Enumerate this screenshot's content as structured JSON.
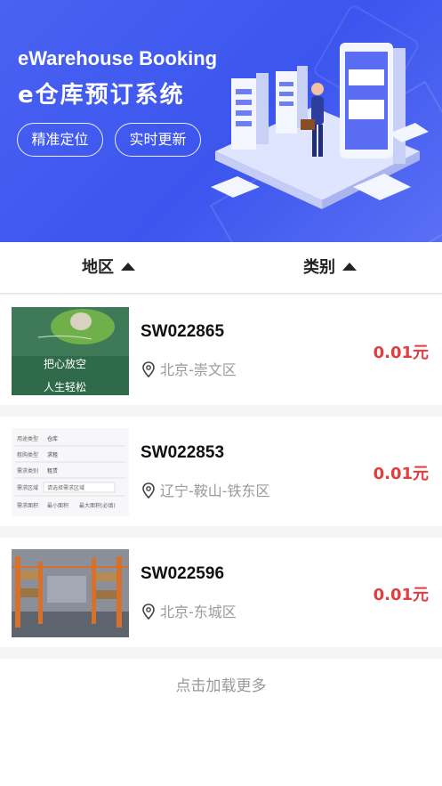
{
  "banner": {
    "title_en": "eWarehouse Booking",
    "title_cn": "e仓库预订系统",
    "pill_1": "精准定位",
    "pill_2": "实时更新"
  },
  "filters": {
    "region_label": "地区",
    "category_label": "类别"
  },
  "listings": [
    {
      "id": "SW022865",
      "location": "北京-崇文区",
      "price": "0.01元"
    },
    {
      "id": "SW022853",
      "location": "辽宁-鞍山-铁东区",
      "price": "0.01元"
    },
    {
      "id": "SW022596",
      "location": "北京-东城区",
      "price": "0.01元"
    }
  ],
  "thumb1_text": {
    "line1": "把心放空",
    "line2": "人生轻松"
  },
  "thumb2_form": [
    {
      "label": "用途类型",
      "value": "仓库"
    },
    {
      "label": "租购类型",
      "value": "求租"
    },
    {
      "label": "需求类别",
      "value": "租赁"
    },
    {
      "label": "需求区域",
      "value": "请选择需求区域"
    },
    {
      "label": "需求面积",
      "value": "最小面积",
      "value2": "最大面积(必填)"
    }
  ],
  "load_more": "点击加载更多",
  "colors": {
    "banner": "#4a62f2",
    "price": "#e33c3c"
  }
}
